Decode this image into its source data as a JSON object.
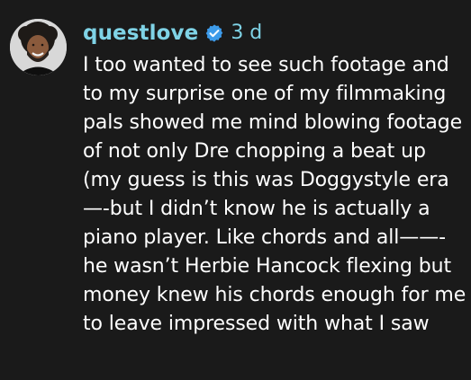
{
  "comment": {
    "username": "questlove",
    "verified": true,
    "verified_color": "#3d9bea",
    "time": "3 d",
    "text": "I too wanted to see such footage and to my surprise one of my filmmaking pals showed me mind blowing footage of not only Dre chopping a beat up (my guess is this was Doggystyle era—-but I didn’t know he is actually a piano player. Like chords and all——-he wasn’t Herbie Hancock flexing but money knew his chords enough for me to leave impressed with what I saw",
    "avatar_icon": "profile-photo",
    "accent_color": "#7fd3e6",
    "text_color": "#ffffff",
    "background_color": "#1a1a1a"
  }
}
